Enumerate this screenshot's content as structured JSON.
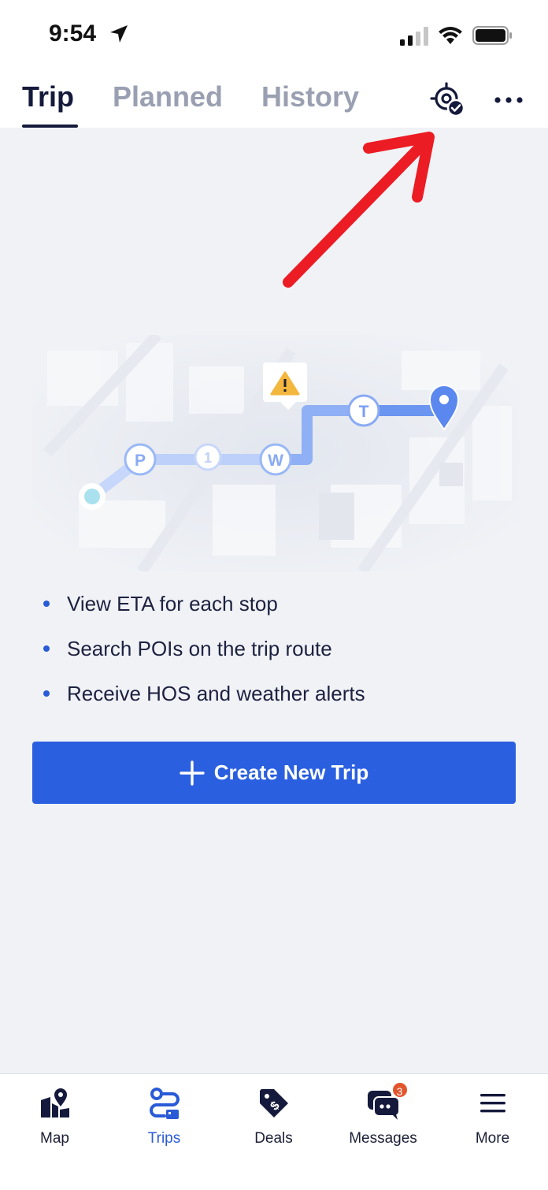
{
  "status_bar": {
    "time": "9:54"
  },
  "tabs": [
    {
      "label": "Trip",
      "active": true
    },
    {
      "label": "Planned",
      "active": false
    },
    {
      "label": "History",
      "active": false
    }
  ],
  "header_icons": {
    "locate": "locate-check-icon",
    "more": "more-horizontal-icon"
  },
  "illustration": {
    "route_markers": [
      "P",
      "1",
      "W",
      "T"
    ],
    "alert_icon": "warning-icon",
    "destination_icon": "location-pin-icon"
  },
  "features": [
    "View ETA for each stop",
    "Search POIs on the trip route",
    "Receive HOS and weather alerts"
  ],
  "create_button": {
    "label": "Create New Trip",
    "icon": "plus-icon"
  },
  "bottom_nav": [
    {
      "label": "Map",
      "icon": "map-pin-icon",
      "active": false
    },
    {
      "label": "Trips",
      "icon": "route-icon",
      "active": true
    },
    {
      "label": "Deals",
      "icon": "price-tag-icon",
      "active": false
    },
    {
      "label": "Messages",
      "icon": "chat-icon",
      "active": false,
      "badge": "3"
    },
    {
      "label": "More",
      "icon": "menu-icon",
      "active": false
    }
  ],
  "colors": {
    "accent": "#2a5fe0",
    "annotation": "#ec1c24",
    "badge": "#e2542c",
    "background": "#f0f2f6"
  }
}
